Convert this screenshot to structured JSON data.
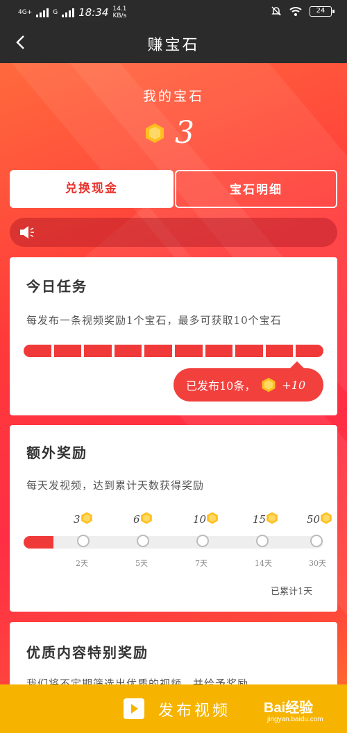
{
  "status_bar": {
    "network_1": "4G+",
    "network_2": "G",
    "time": "18:34",
    "speed_top": "14.1",
    "speed_bottom": "KB/s",
    "battery": "24"
  },
  "header": {
    "title": "赚宝石",
    "back_icon": "chevron-left-icon"
  },
  "gems": {
    "label": "我的宝石",
    "count": "3"
  },
  "tabs": [
    {
      "label": "兑换现金",
      "active": true
    },
    {
      "label": "宝石明细",
      "active": false
    }
  ],
  "daily_task": {
    "title": "今日任务",
    "desc": "每发布一条视频奖励1个宝石，最多可获取10个宝石",
    "segments_total": 10,
    "segments_done": 10,
    "bubble_text": "已发布10条，",
    "bubble_reward": "+10"
  },
  "extra_reward": {
    "title": "额外奖励",
    "desc": "每天发视频，达到累计天数获得奖励",
    "milestones": [
      {
        "reward": "3",
        "day": "2天"
      },
      {
        "reward": "6",
        "day": "5天"
      },
      {
        "reward": "10",
        "day": "7天"
      },
      {
        "reward": "15",
        "day": "14天"
      },
      {
        "reward": "50",
        "day": "30天"
      }
    ],
    "progress_fraction": 0.1,
    "accumulated": "已累计1天"
  },
  "quality_reward": {
    "title": "优质内容特别奖励",
    "desc_partial": "我们将不定期筛选出优质的视频，并给予奖励"
  },
  "bottom": {
    "publish_label": "发布视频",
    "watermark": "Bai经验",
    "watermark_sub": "jingyan.baidu.com"
  },
  "colors": {
    "accent": "#f03a3a",
    "bottom_bar": "#f6b400",
    "gem": "#ffbf1f"
  }
}
